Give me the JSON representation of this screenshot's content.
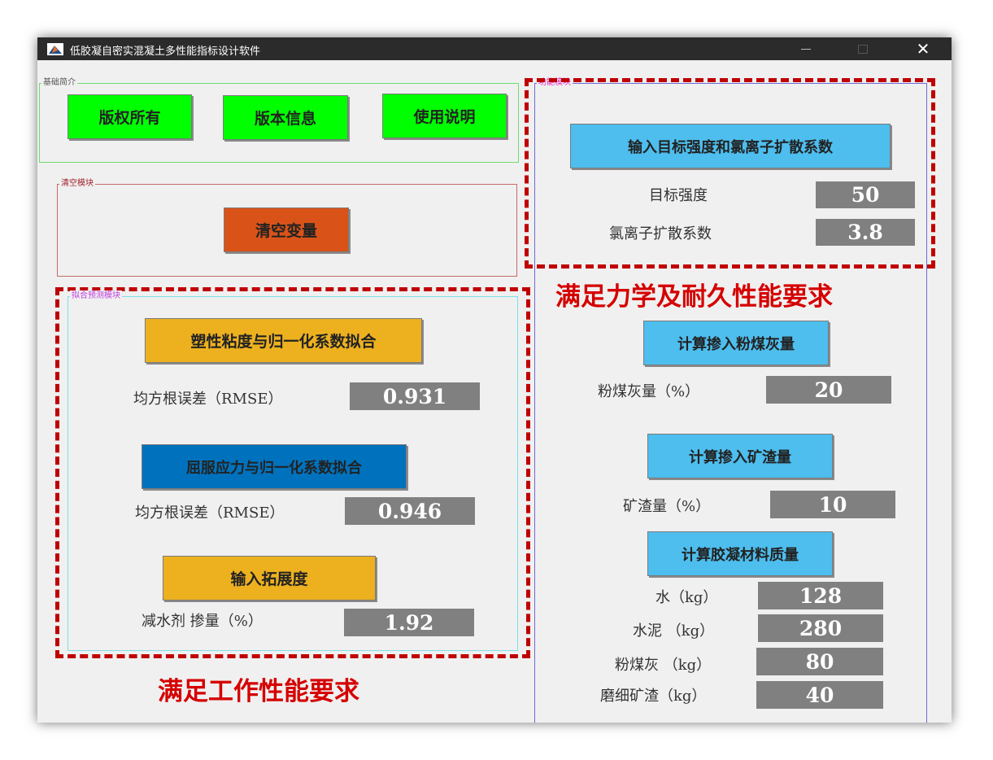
{
  "window": {
    "title": "低胶凝自密实混凝土多性能指标设计软件",
    "close_glyph": "✕"
  },
  "panels": {
    "intro": {
      "title": "基础简介",
      "buttons": [
        "版权所有",
        "版本信息",
        "使用说明"
      ]
    },
    "clear": {
      "title": "清空模块",
      "button": "清空变量"
    },
    "fitting": {
      "title": "拟合预测模块",
      "fit1_button": "塑性粘度与归一化系数拟合",
      "rmse_label": "均方根误差（RMSE）",
      "rmse1_value": "0.931",
      "fit2_button": "屈服应力与归一化系数拟合",
      "rmse2_value": "0.946",
      "spread_button": "输入拓展度",
      "reducer_label": "减水剂 掺量（%）",
      "reducer_value": "1.92"
    },
    "function": {
      "title": "功能模块",
      "input_button": "输入目标强度和氯离子扩散系数",
      "strength_label": "目标强度",
      "strength_value": "50",
      "chloride_label": "氯离子扩散系数",
      "chloride_value": "3.8",
      "flyash_button": "计算掺入粉煤灰量",
      "flyash_label": "粉煤灰量（%）",
      "flyash_value": "20",
      "slag_button": "计算掺入矿渣量",
      "slag_label": "矿渣量（%）",
      "slag_value": "10",
      "binder_button": "计算胶凝材料质量",
      "materials": [
        {
          "label": "水（kg）",
          "value": "128"
        },
        {
          "label": "水泥 （kg）",
          "value": "280"
        },
        {
          "label": "粉煤灰 （kg）",
          "value": "80"
        },
        {
          "label": "磨细矿渣（kg）",
          "value": "40"
        }
      ]
    }
  },
  "annotations": {
    "mechanical": "满足力学及耐久性能要求",
    "workability": "满足工作性能要求"
  },
  "colors": {
    "green_button": "#00ff00",
    "orange_button": "#d95319",
    "gold_button": "#edb120",
    "blue_button": "#0072bd",
    "sky_button": "#4dbeee",
    "value_box": "#808080",
    "annotation_red": "#d50000"
  }
}
